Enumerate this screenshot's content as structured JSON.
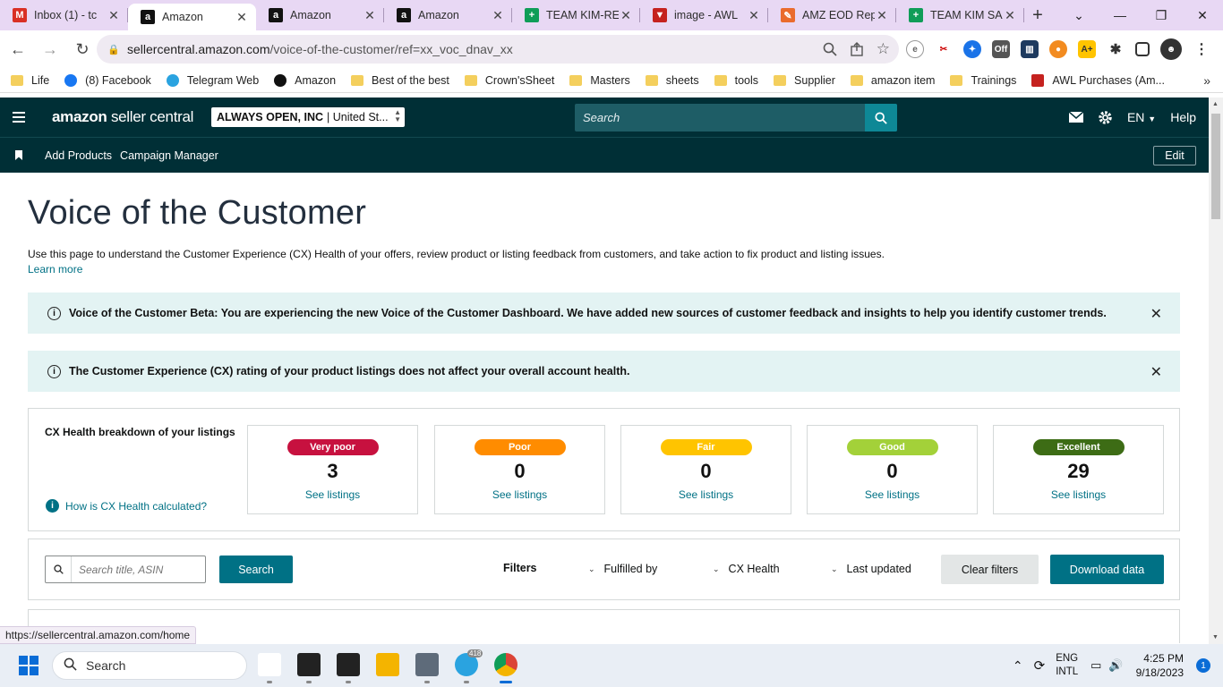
{
  "browser": {
    "tabs": [
      {
        "title": "Inbox (1) - tc",
        "favicon": "gmail-icon",
        "color": "#d93025",
        "glyph": "M"
      },
      {
        "title": "Amazon",
        "favicon": "amazon-icon",
        "color": "#111111",
        "glyph": "a",
        "active": true
      },
      {
        "title": "Amazon",
        "favicon": "amazon-icon",
        "color": "#111111",
        "glyph": "a"
      },
      {
        "title": "Amazon",
        "favicon": "amazon-icon",
        "color": "#111111",
        "glyph": "a"
      },
      {
        "title": "TEAM KIM-RE",
        "favicon": "sheets-icon",
        "color": "#0f9d58",
        "glyph": "+"
      },
      {
        "title": "image - AWL",
        "favicon": "awl-icon",
        "color": "#c5221f",
        "glyph": "▼"
      },
      {
        "title": "AMZ EOD Rep",
        "favicon": "pen-icon",
        "color": "#ea6b2d",
        "glyph": "✎"
      },
      {
        "title": "TEAM KIM SA",
        "favicon": "sheets-icon",
        "color": "#0f9d58",
        "glyph": "+"
      }
    ],
    "url_host": "sellercentral.amazon.com",
    "url_path": "/voice-of-the-customer/ref=xx_voc_dnav_xx",
    "bookmarks": [
      {
        "label": "Life",
        "type": "folder"
      },
      {
        "label": "(8) Facebook",
        "type": "facebook"
      },
      {
        "label": "Telegram Web",
        "type": "telegram"
      },
      {
        "label": "Amazon",
        "type": "amazon"
      },
      {
        "label": "Best of the best",
        "type": "folder"
      },
      {
        "label": "Crown'sSheet",
        "type": "folder"
      },
      {
        "label": "Masters",
        "type": "folder"
      },
      {
        "label": "sheets",
        "type": "folder"
      },
      {
        "label": "tools",
        "type": "folder"
      },
      {
        "label": "Supplier",
        "type": "folder"
      },
      {
        "label": "amazon item",
        "type": "folder"
      },
      {
        "label": "Trainings",
        "type": "folder"
      },
      {
        "label": "AWL Purchases (Am...",
        "type": "awl"
      }
    ]
  },
  "header": {
    "logo_bold": "amazon",
    "logo_light": "seller central",
    "account_name": "ALWAYS OPEN, INC",
    "account_market": "| United St...",
    "search_placeholder": "Search",
    "lang": "EN",
    "help": "Help"
  },
  "subnav": {
    "links": [
      "Add Products",
      "Campaign Manager"
    ],
    "edit": "Edit"
  },
  "page": {
    "title": "Voice of the Customer",
    "description": "Use this page to understand the Customer Experience (CX) Health of your offers, review product or listing feedback from customers, and take action to fix product and listing issues.",
    "learn_more": "Learn more",
    "banner1": "Voice of the Customer Beta: You are experiencing the new Voice of the Customer Dashboard. We have added new sources of customer feedback and insights to help you identify customer trends.",
    "banner2": "The Customer Experience (CX) rating of your product listings does not affect your overall account health."
  },
  "cx": {
    "title": "CX Health breakdown of your listings",
    "how_link": "How is CX Health calculated?",
    "see_listings": "See listings",
    "cards": [
      {
        "label": "Very poor",
        "count": "3",
        "color": "#c7113f",
        "text_color": "#ffffff"
      },
      {
        "label": "Poor",
        "count": "0",
        "color": "#ff8c00",
        "text_color": "#ffffff"
      },
      {
        "label": "Fair",
        "count": "0",
        "color": "#ffc400",
        "text_color": "#ffffff"
      },
      {
        "label": "Good",
        "count": "0",
        "color": "#a3d139",
        "text_color": "#ffffff"
      },
      {
        "label": "Excellent",
        "count": "29",
        "color": "#3d6c15",
        "text_color": "#ffffff"
      }
    ]
  },
  "filters": {
    "search_placeholder": "Search title, ASIN",
    "search_button": "Search",
    "label": "Filters",
    "fulfilled_by": "Fulfilled by",
    "cx_health": "CX Health",
    "last_updated": "Last updated",
    "clear": "Clear filters",
    "download": "Download data"
  },
  "status_url": "https://sellercentral.amazon.com/home",
  "taskbar": {
    "search": "Search",
    "telegram_badge": "418",
    "lang_line1": "ENG",
    "lang_line2": "INTL",
    "time": "4:25 PM",
    "date": "9/18/2023",
    "notifications": "1"
  }
}
